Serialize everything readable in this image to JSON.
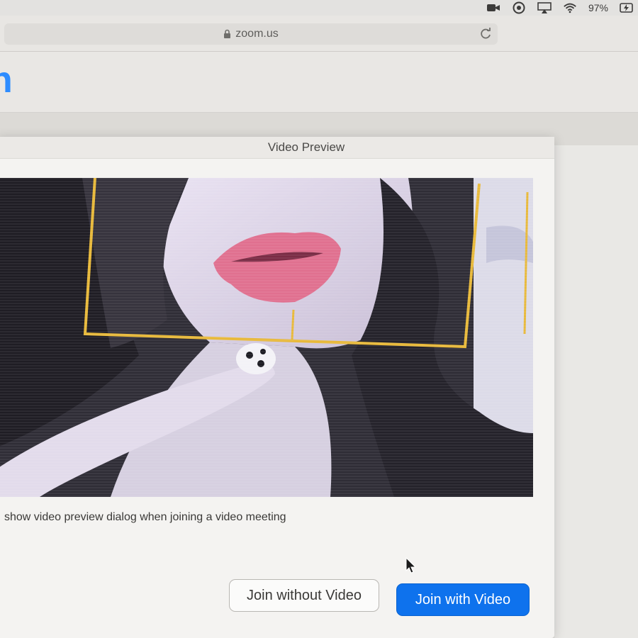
{
  "menubar": {
    "battery_label": "97%",
    "icons": [
      "zoom-camera-icon",
      "status-icon",
      "airplay-icon",
      "wifi-icon",
      "battery-icon"
    ]
  },
  "browser": {
    "url": "zoom.us",
    "icons": [
      "lock-icon",
      "reload-icon"
    ]
  },
  "site": {
    "logo_partial": "n",
    "brand_color": "#2d8cff"
  },
  "dialog": {
    "title": "Video Preview",
    "checkbox_label": "show video preview dialog when joining a video meeting",
    "checkbox_checked": false,
    "buttons": {
      "join_without_video": "Join without Video",
      "join_with_video": "Join with Video"
    },
    "primary_color": "#0e72ed"
  }
}
